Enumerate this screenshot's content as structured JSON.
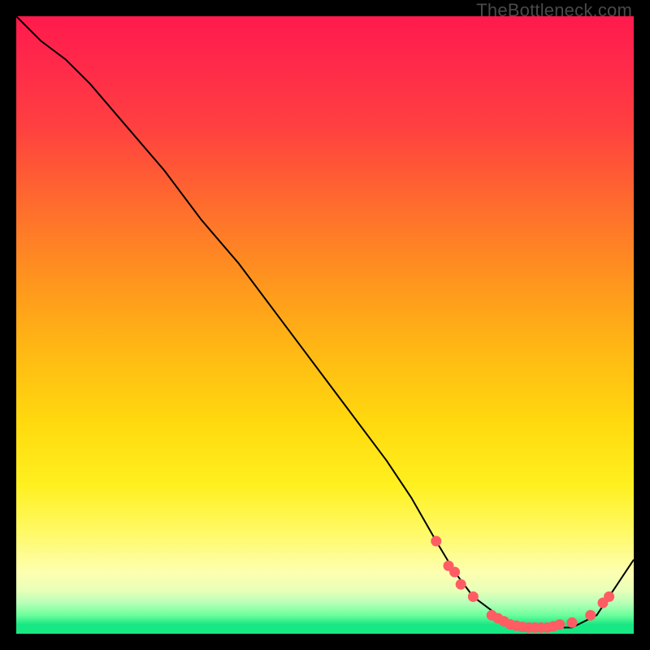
{
  "watermark": "TheBottleneck.com",
  "chart_data": {
    "type": "line",
    "title": "",
    "xlabel": "",
    "ylabel": "",
    "xlim": [
      0,
      100
    ],
    "ylim": [
      0,
      100
    ],
    "grid": false,
    "legend": false,
    "background_gradient": [
      "#ff1a4d",
      "#ff921f",
      "#ffda0e",
      "#fdffb0",
      "#18e884"
    ],
    "series": [
      {
        "name": "bottleneck-curve",
        "color": "#000000",
        "x": [
          0,
          4,
          8,
          12,
          18,
          24,
          30,
          36,
          42,
          48,
          54,
          60,
          64,
          68,
          71,
          74,
          78,
          82,
          86,
          90,
          94,
          98,
          100
        ],
        "values": [
          100,
          96,
          93,
          89,
          82,
          75,
          67,
          60,
          52,
          44,
          36,
          28,
          22,
          15,
          10,
          6,
          3,
          1,
          1,
          1,
          3,
          9,
          12
        ]
      }
    ],
    "markers": {
      "name": "highlight-points",
      "color": "#ff5d63",
      "points": [
        {
          "x": 68,
          "y": 15
        },
        {
          "x": 70,
          "y": 11
        },
        {
          "x": 71,
          "y": 10
        },
        {
          "x": 72,
          "y": 8
        },
        {
          "x": 74,
          "y": 6
        },
        {
          "x": 77,
          "y": 3
        },
        {
          "x": 78,
          "y": 2.5
        },
        {
          "x": 79,
          "y": 2
        },
        {
          "x": 80,
          "y": 1.5
        },
        {
          "x": 81,
          "y": 1.3
        },
        {
          "x": 82,
          "y": 1.1
        },
        {
          "x": 83,
          "y": 1
        },
        {
          "x": 84,
          "y": 1
        },
        {
          "x": 85,
          "y": 1
        },
        {
          "x": 86,
          "y": 1
        },
        {
          "x": 87,
          "y": 1.2
        },
        {
          "x": 88,
          "y": 1.5
        },
        {
          "x": 90,
          "y": 1.8
        },
        {
          "x": 93,
          "y": 3
        },
        {
          "x": 95,
          "y": 5
        },
        {
          "x": 96,
          "y": 6
        }
      ]
    }
  }
}
